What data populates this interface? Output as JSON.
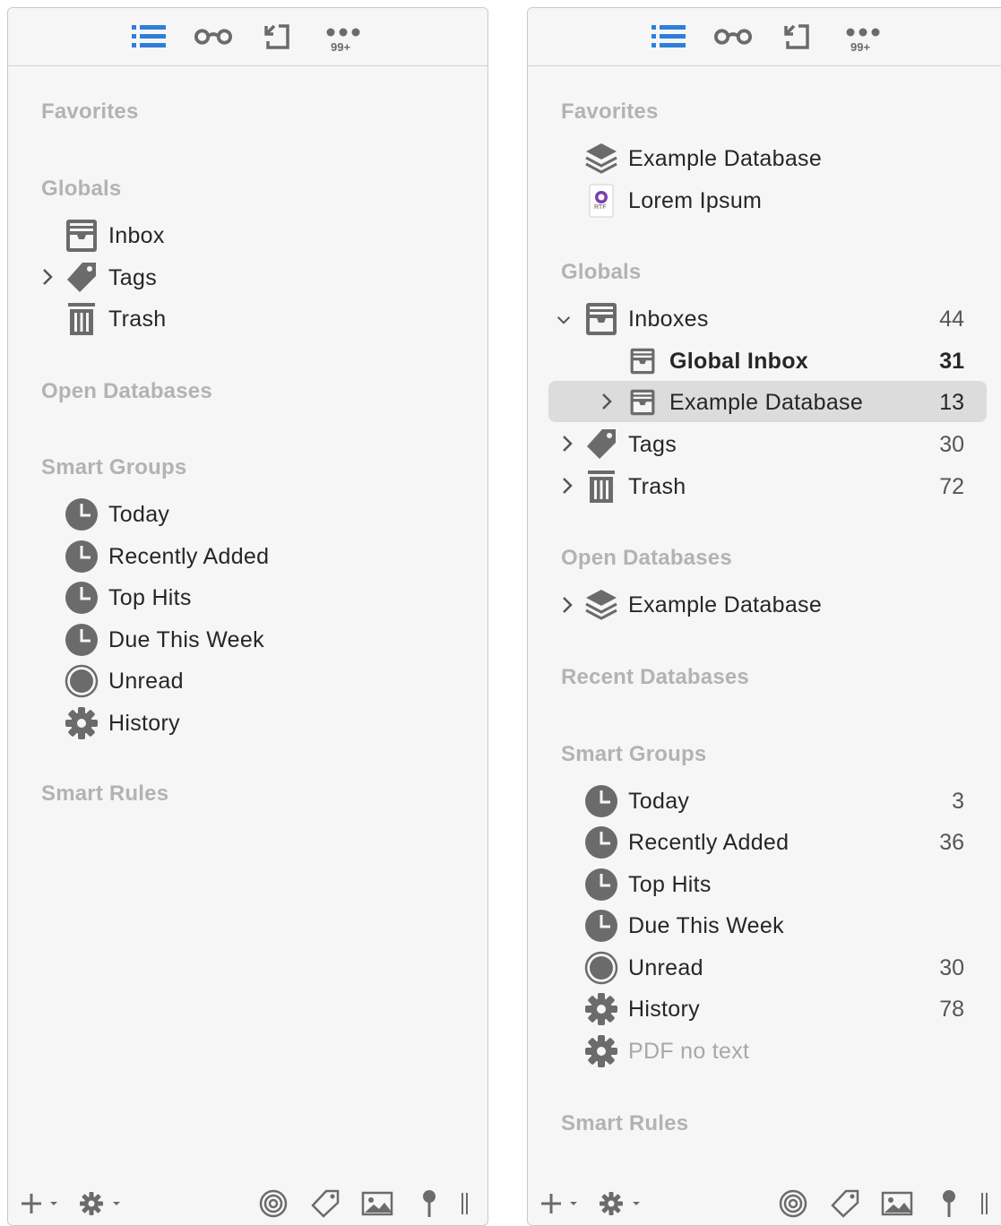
{
  "colors": {
    "panel_bg": "#f6f6f6",
    "accent": "#2f7fd9",
    "icon_gray": "#6b6b6b",
    "section_header": "#b3b3b3",
    "selected_row": "#dcdcdc"
  },
  "toolbar": {
    "icons": [
      "list-view-icon",
      "glasses-icon",
      "import-icon",
      "more-icon"
    ],
    "badge": "99+"
  },
  "left": {
    "sections": {
      "favorites": "Favorites",
      "globals": "Globals",
      "open_databases": "Open Databases",
      "smart_groups": "Smart Groups",
      "smart_rules": "Smart Rules"
    },
    "globals": [
      {
        "label": "Inbox"
      },
      {
        "label": "Tags"
      },
      {
        "label": "Trash"
      }
    ],
    "smart_groups": [
      {
        "label": "Today"
      },
      {
        "label": "Recently Added"
      },
      {
        "label": "Top Hits"
      },
      {
        "label": "Due This Week"
      },
      {
        "label": "Unread"
      },
      {
        "label": "History"
      }
    ]
  },
  "right": {
    "sections": {
      "favorites": "Favorites",
      "globals": "Globals",
      "open_databases": "Open Databases",
      "recent_databases": "Recent Databases",
      "smart_groups": "Smart Groups",
      "smart_rules": "Smart Rules"
    },
    "favorites": [
      {
        "label": "Example Database"
      },
      {
        "label": "Lorem Ipsum"
      }
    ],
    "rtf_label": "RTF",
    "globals": [
      {
        "label": "Inboxes",
        "count": "44"
      },
      {
        "label": "Global Inbox",
        "count": "31"
      },
      {
        "label": "Example Database",
        "count": "13"
      },
      {
        "label": "Tags",
        "count": "30"
      },
      {
        "label": "Trash",
        "count": "72"
      }
    ],
    "open_databases": [
      {
        "label": "Example Database"
      }
    ],
    "smart_groups": [
      {
        "label": "Today",
        "count": "3"
      },
      {
        "label": "Recently Added",
        "count": "36"
      },
      {
        "label": "Top Hits",
        "count": ""
      },
      {
        "label": "Due This Week",
        "count": ""
      },
      {
        "label": "Unread",
        "count": "30"
      },
      {
        "label": "History",
        "count": "78"
      },
      {
        "label": "PDF no text",
        "count": ""
      }
    ]
  },
  "bottombar": {
    "icons": [
      "add-icon",
      "gear-menu-icon",
      "target-icon",
      "tag-icon",
      "image-icon",
      "pin-icon",
      "sidebar-handle-icon"
    ]
  }
}
